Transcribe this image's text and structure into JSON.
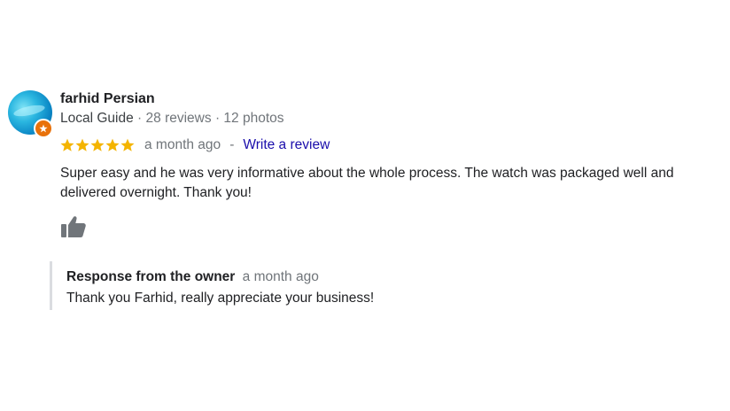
{
  "review": {
    "author": "farhid Persian",
    "badge": "Local Guide",
    "reviews_count": "28 reviews",
    "photos_count": "12 photos",
    "meta_separator": "·",
    "rating": 5,
    "max_rating": 5,
    "time_ago": "a month ago",
    "dash": "-",
    "write_review_label": "Write a review",
    "text": "Super easy and he was very informative about the whole process. The watch was packaged well and delivered overnight. Thank you!"
  },
  "owner_response": {
    "title": "Response from the owner",
    "time_ago": "a month ago",
    "text": "Thank you Farhid, really appreciate your business!"
  },
  "colors": {
    "star": "#f4b400",
    "link": "#1a0dab",
    "badge": "#e8710a",
    "muted": "#70757a",
    "icon": "#70757a"
  },
  "icons": {
    "avatar": "profile-photo-water",
    "guide_badge": "local-guide-star-icon",
    "like": "thumbs-up-icon"
  }
}
